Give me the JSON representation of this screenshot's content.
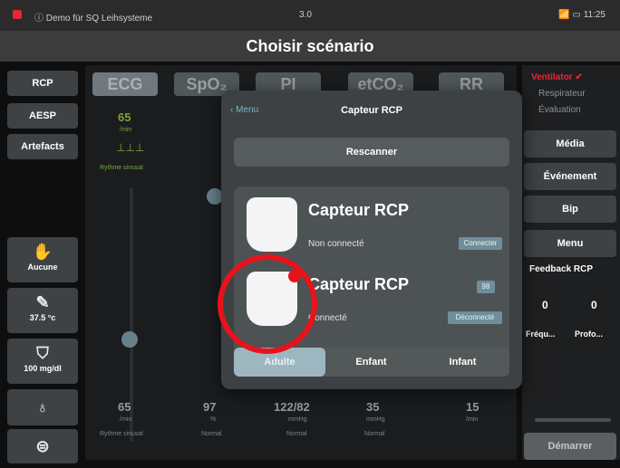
{
  "status_bar": {
    "app": "Demo für SQ Leihsysteme",
    "version": "3.0",
    "time": "11:25"
  },
  "title": "Choisir scénario",
  "left_nav": {
    "buttons": [
      "RCP",
      "AESP",
      "Artefacts"
    ],
    "tools": [
      {
        "icon": "hand-icon",
        "label": "Aucune"
      },
      {
        "icon": "thermometer-icon",
        "label": "37.5 °c"
      },
      {
        "icon": "glucose-icon",
        "label": "100 mg/dl"
      },
      {
        "icon": "stethoscope-icon",
        "label": ""
      },
      {
        "icon": "toggle-icon",
        "label": ""
      }
    ]
  },
  "monitor": {
    "tabs": [
      "ECG",
      "SpO₂",
      "PI",
      "etCO₂",
      "RR"
    ],
    "top_readout": {
      "value": "65",
      "unit": "/min",
      "wave_label": "Rythme sinusal"
    },
    "bottom_values": [
      {
        "value": "65",
        "unit": "/min",
        "label": "Rythme sinusal"
      },
      {
        "value": "97",
        "unit": "%",
        "label": "Normal"
      },
      {
        "value": "122/82",
        "unit": "mmHg",
        "label": "Normal"
      },
      {
        "value": "35",
        "unit": "mmHg",
        "label": "Normal"
      },
      {
        "value": "15",
        "unit": "/min",
        "label": ""
      }
    ]
  },
  "right_panel": {
    "status_lines": [
      "Ventilator ✔",
      "Respirateur",
      "Évaluation"
    ],
    "buttons": [
      "Média",
      "Événement",
      "Bip",
      "Menu"
    ],
    "feedback_title": "Feedback RCP",
    "feedback_values": [
      "0",
      "0"
    ],
    "feedback_labels": [
      "Fréqu...",
      "Profo..."
    ],
    "start": "Démarrer"
  },
  "popover": {
    "back": "Menu",
    "title": "Capteur RCP",
    "rescan": "Rescanner",
    "sensors": [
      {
        "name": "Capteur RCP",
        "state": "Non connecté",
        "action": "Connecter",
        "badge": ""
      },
      {
        "name": "Capteur RCP",
        "state": "Connecté",
        "action": "Déconnecté",
        "badge": "98"
      }
    ],
    "segments": [
      "Adulte",
      "Enfant",
      "Infant"
    ],
    "selected_segment": "Adulte"
  },
  "colors": {
    "accent": "#6e8f9a",
    "highlight_circle": "#e8121c",
    "status_red": "#e8253a",
    "ecg_green": "#a6e34a"
  }
}
